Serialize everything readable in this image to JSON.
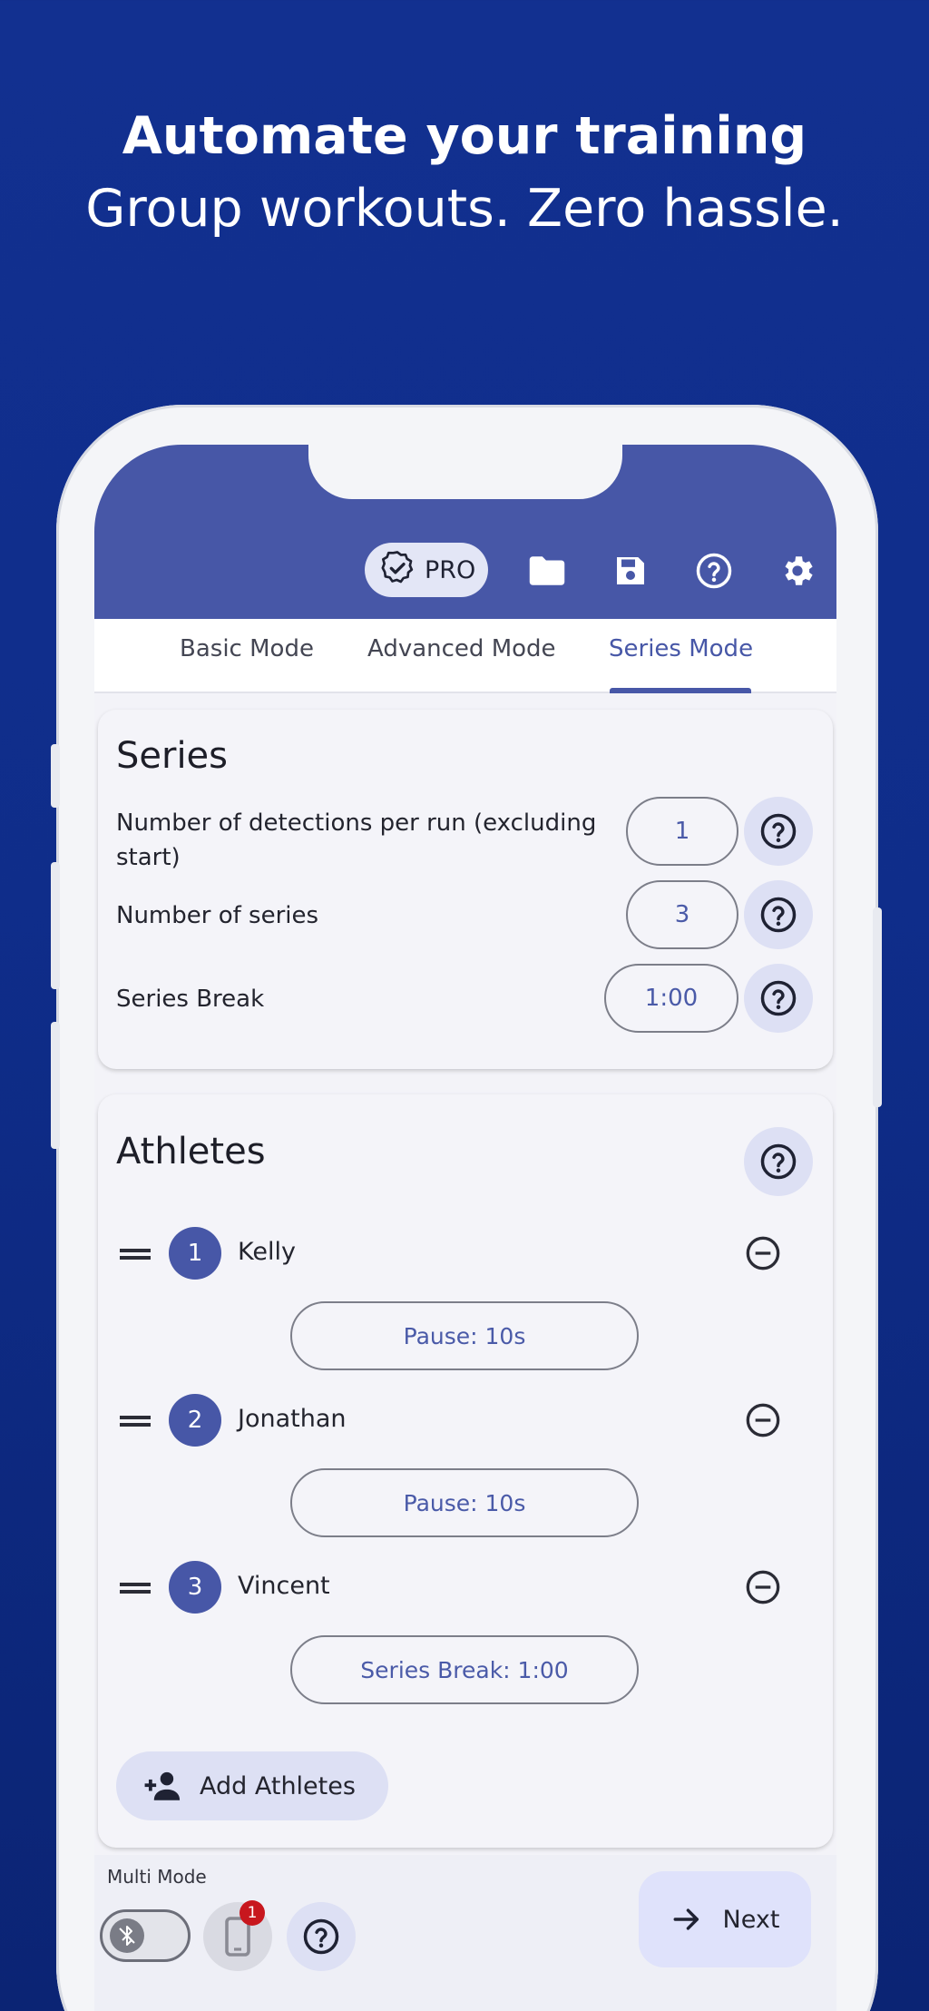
{
  "banner": {
    "headline": "Automate your training",
    "subline": "Group workouts. Zero hassle."
  },
  "appbar": {
    "pro_label": "PRO",
    "icons": [
      "verified-badge-icon",
      "folder-icon",
      "save-icon",
      "help-icon",
      "settings-icon"
    ]
  },
  "tabs": [
    {
      "label": "Basic Mode",
      "active": false
    },
    {
      "label": "Advanced Mode",
      "active": false
    },
    {
      "label": "Series Mode",
      "active": true
    }
  ],
  "series": {
    "title": "Series",
    "rows": [
      {
        "label": "Number of detections per run (excluding start)",
        "value": "1"
      },
      {
        "label": "Number of series",
        "value": "3"
      },
      {
        "label": "Series Break",
        "value": "1:00"
      }
    ]
  },
  "athletes": {
    "title": "Athletes",
    "items": [
      {
        "number": "1",
        "name": "Kelly",
        "pause": "Pause: 10s"
      },
      {
        "number": "2",
        "name": "Jonathan",
        "pause": "Pause: 10s"
      },
      {
        "number": "3",
        "name": "Vincent",
        "pause": "Series Break: 1:00"
      }
    ],
    "add_label": "Add Athletes"
  },
  "bottom": {
    "multi_mode_label": "Multi Mode",
    "multi_mode_on": false,
    "device_badge": "1",
    "next_label": "Next"
  },
  "colors": {
    "primary": "#4757a7",
    "background": "#123090",
    "badge": "#c8171e"
  }
}
